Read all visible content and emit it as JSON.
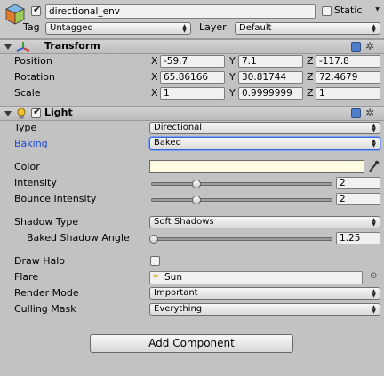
{
  "object": {
    "name": "directional_env",
    "active": true,
    "static_label": "Static",
    "static_checked": false,
    "tag_label": "Tag",
    "tag_value": "Untagged",
    "layer_label": "Layer",
    "layer_value": "Default"
  },
  "transform": {
    "title": "Transform",
    "rows": [
      {
        "label": "Position",
        "x": "-59.7",
        "y": "7.1",
        "z": "-117.8"
      },
      {
        "label": "Rotation",
        "x": "65.86166",
        "y": "30.81744",
        "z": "72.4679"
      },
      {
        "label": "Scale",
        "x": "1",
        "y": "0.9999999",
        "z": "1"
      }
    ],
    "axis_x": "X",
    "axis_y": "Y",
    "axis_z": "Z"
  },
  "light": {
    "title": "Light",
    "enabled": true,
    "type_label": "Type",
    "type_value": "Directional",
    "baking_label": "Baking",
    "baking_value": "Baked",
    "color_label": "Color",
    "color_value": "#fffbe0",
    "intensity_label": "Intensity",
    "intensity_value": "2",
    "intensity_fraction": 0.25,
    "bounce_label": "Bounce Intensity",
    "bounce_value": "2",
    "bounce_fraction": 0.25,
    "shadow_type_label": "Shadow Type",
    "shadow_type_value": "Soft Shadows",
    "baked_angle_label": "Baked Shadow Angle",
    "baked_angle_value": "1.25",
    "baked_angle_fraction": 0.014,
    "draw_halo_label": "Draw Halo",
    "draw_halo_checked": false,
    "flare_label": "Flare",
    "flare_value": "Sun",
    "render_mode_label": "Render Mode",
    "render_mode_value": "Important",
    "culling_label": "Culling Mask",
    "culling_value": "Everything"
  },
  "footer": {
    "add_component_label": "Add Component"
  },
  "colors": {
    "panel_bg": "#c2c2c2",
    "baking_label": "#1a47d6",
    "header_band": "#c8c8c8"
  }
}
